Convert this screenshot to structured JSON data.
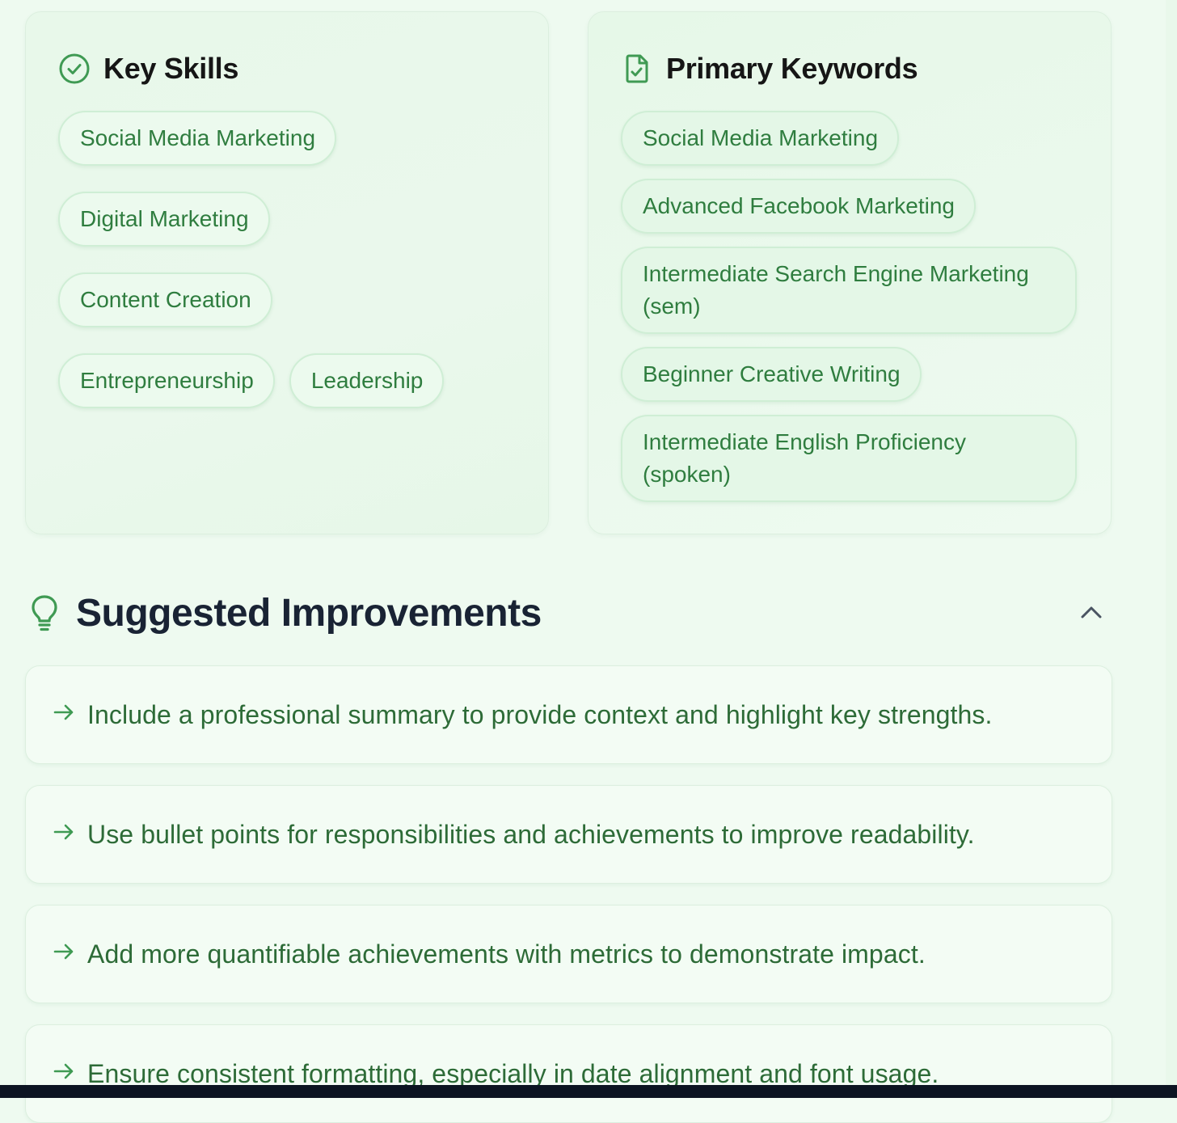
{
  "skills_card": {
    "title": "Key Skills",
    "chips": [
      "Social Media Marketing",
      "Digital Marketing",
      "Content Creation",
      "Entrepreneurship",
      "Leadership"
    ]
  },
  "keywords_card": {
    "title": "Primary Keywords",
    "chips": [
      "Social Media Marketing",
      "Advanced Facebook Marketing",
      "Intermediate Search Engine Marketing (sem)",
      "Beginner Creative Writing",
      "Intermediate English Proficiency (spoken)"
    ]
  },
  "improvements": {
    "title": "Suggested Improvements",
    "items": [
      "Include a professional summary to provide context and highlight key strengths.",
      "Use bullet points for responsibilities and achievements to improve readability.",
      "Add more quantifiable achievements with metrics to demonstrate impact.",
      "Ensure consistent formatting, especially in date alignment and font usage."
    ]
  },
  "icons": {
    "skills": "check-circle-icon",
    "keywords": "file-check-icon",
    "improvements": "lightbulb-icon",
    "collapse": "chevron-up-icon",
    "item": "arrow-right-icon"
  },
  "colors": {
    "accent": "#2f7d3f",
    "heading": "#192334",
    "background": "#eefaf0"
  }
}
